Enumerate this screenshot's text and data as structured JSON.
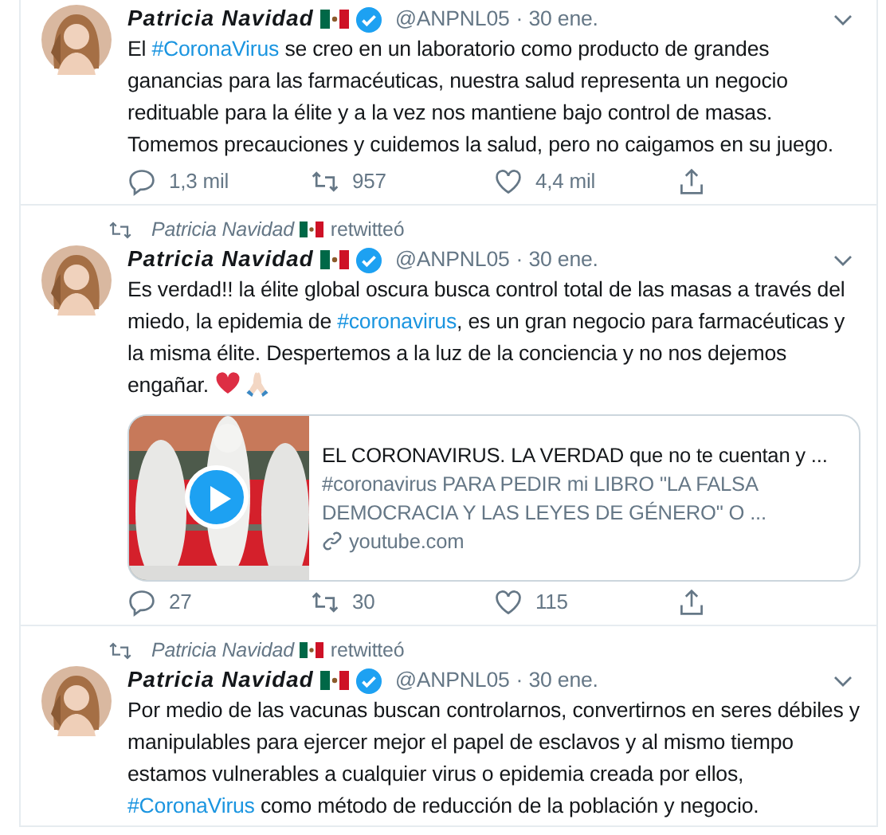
{
  "tweets": [
    {
      "name": "Patricia Navidad",
      "handle": "@ANPNL05",
      "date": "· 30 ene.",
      "text": [
        {
          "kind": "plain",
          "text": "El "
        },
        {
          "kind": "hashtag",
          "text": "#CoronaVirus"
        },
        {
          "kind": "plain",
          "text": " se creo en un laboratorio como producto de grandes ganancias para las farmacéuticas, nuestra salud representa un negocio redituable para la élite y a la vez nos mantiene bajo control de masas. Tomemos precauciones y cuidemos la salud, pero no caigamos en su juego."
        }
      ],
      "actions": {
        "replies": "1,3 mil",
        "retweets": "957",
        "likes": "4,4 mil"
      }
    },
    {
      "retweeted_by": {
        "name": "Patricia Navidad",
        "label": "retwitteó"
      },
      "name": "Patricia Navidad",
      "handle": "@ANPNL05",
      "date": "· 30 ene.",
      "text": [
        {
          "kind": "plain",
          "text": "Es verdad!! la élite global oscura busca control total de las masas a través del miedo, la epidemia de "
        },
        {
          "kind": "hashtag",
          "text": "#coronavirus"
        },
        {
          "kind": "plain",
          "text": ", es un gran negocio para farmacéuticas y la misma élite. Despertemos a la luz de la conciencia y no nos dejemos engañar."
        }
      ],
      "emoji": true,
      "card": {
        "title": "EL CORONAVIRUS. LA VERDAD que no te cuentan y ...",
        "description": "#coronavirus PARA PEDIR mi LIBRO \"LA FALSA DEMOCRACIA Y LAS LEYES DE GÉNERO\" O ...",
        "domain": "youtube.com"
      },
      "actions": {
        "replies": "27",
        "retweets": "30",
        "likes": "115"
      }
    },
    {
      "retweeted_by": {
        "name": "Patricia Navidad",
        "label": "retwitteó"
      },
      "name": "Patricia Navidad",
      "handle": "@ANPNL05",
      "date": "· 30 ene.",
      "text": [
        {
          "kind": "plain",
          "text": "Por medio de las vacunas buscan controlarnos, convertirnos en seres débiles y manipulables para ejercer mejor el papel de esclavos y al mismo tiempo estamos vulnerables a cualquier virus o epidemia creada por ellos, "
        },
        {
          "kind": "hashtag",
          "text": "#CoronaVirus"
        },
        {
          "kind": "plain",
          "text": " como método de reducción de la población y negocio."
        }
      ]
    }
  ]
}
